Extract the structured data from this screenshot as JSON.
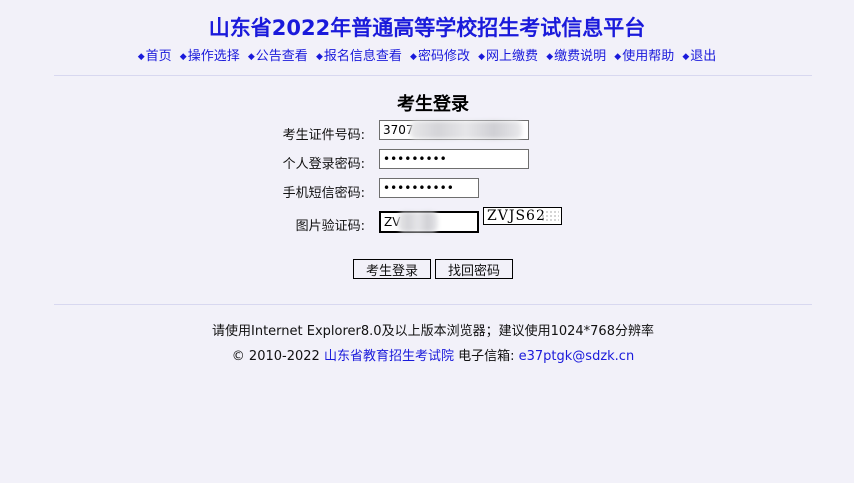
{
  "header": {
    "title": "山东省2022年普通高等学校招生考试信息平台",
    "nav": [
      "首页",
      "操作选择",
      "公告查看",
      "报名信息查看",
      "密码修改",
      "网上缴费",
      "缴费说明",
      "使用帮助",
      "退出"
    ],
    "nav_bullet": "◆"
  },
  "login": {
    "title": "考生登录",
    "id_label": "考生证件号码:",
    "id_value": "3707",
    "password_label": "个人登录密码:",
    "password_value": "•••••••••",
    "sms_label": "手机短信密码:",
    "sms_value": "••••••••••",
    "captcha_label": "图片验证码:",
    "captcha_value": "ZV",
    "captcha_image_text": "ZVJS62",
    "login_button": "考生登录",
    "recover_button": "找回密码"
  },
  "footer": {
    "browser_note": "请使用Internet Explorer8.0及以上版本浏览器；建议使用1024*768分辨率",
    "copyright": "© 2010-2022",
    "org_link": "山东省教育招生考试院",
    "email_label": "电子信箱:",
    "email_link": "e37ptgk@sdzk.cn"
  },
  "colors": {
    "background": "#f2f1f9",
    "link": "#1a1adb",
    "title": "#1a1adb"
  }
}
